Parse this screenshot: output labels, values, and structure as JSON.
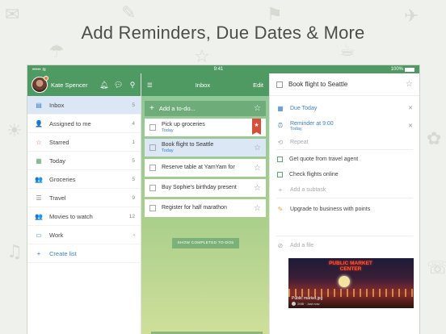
{
  "headline": "Add Reminders, Due Dates & More",
  "statusbar": {
    "left": "••••• ≋",
    "time": "9:41",
    "battery": "100%"
  },
  "user": {
    "name": "Kate Spencer"
  },
  "lists": [
    {
      "label": "Inbox",
      "count": "5",
      "icon": "inbox-icon",
      "glyph": "▤"
    },
    {
      "label": "Assigned to me",
      "count": "4",
      "icon": "person-icon",
      "glyph": "👤"
    },
    {
      "label": "Starred",
      "count": "1",
      "icon": "star-icon",
      "glyph": "☆"
    },
    {
      "label": "Today",
      "count": "5",
      "icon": "calendar-icon",
      "glyph": "▦"
    },
    {
      "label": "Groceries",
      "count": "5",
      "icon": "shared-list-icon",
      "glyph": "👥"
    },
    {
      "label": "Travel",
      "count": "9",
      "icon": "list-icon",
      "glyph": "☰"
    },
    {
      "label": "Movies to watch",
      "count": "12",
      "icon": "shared-list-icon",
      "glyph": "👥"
    },
    {
      "label": "Work",
      "count": "‹",
      "icon": "folder-icon",
      "glyph": "▭"
    },
    {
      "label": "Create list",
      "count": "",
      "icon": "plus-icon",
      "glyph": "+"
    }
  ],
  "inbox": {
    "title": "Inbox",
    "edit": "Edit",
    "add_placeholder": "Add a to-do...",
    "show_completed": "SHOW COMPLETED TO-DOS",
    "tasks": [
      {
        "text": "Pick up groceries",
        "due": "Today",
        "starred": true
      },
      {
        "text": "Book flight to Seattle",
        "due": "Today",
        "starred": false
      },
      {
        "text": "Reserve table at YamYam for",
        "due": "",
        "starred": false
      },
      {
        "text": "Buy Sophie's birthday present",
        "due": "",
        "starred": false
      },
      {
        "text": "Register for half marathon",
        "due": "",
        "starred": false
      }
    ]
  },
  "detail": {
    "title": "Book flight to Seattle",
    "due": "Due Today",
    "reminder": "Reminder at 9:00",
    "reminder_sub": "Today",
    "repeat": "Repeat",
    "subtasks": [
      "Get quote from travel agent",
      "Check flights online"
    ],
    "add_subtask": "Add a subtask",
    "note": "Upgrade to business with points",
    "add_file": "Add a file",
    "file": {
      "sign": "PUBLIC MARKET CENTER",
      "name": "Public market.jpg",
      "meta": "2MB · Just now"
    }
  },
  "colors": {
    "brand_green": "#4f9a62",
    "accent_blue": "#3c7ec9",
    "star_red": "#d74e3a"
  }
}
